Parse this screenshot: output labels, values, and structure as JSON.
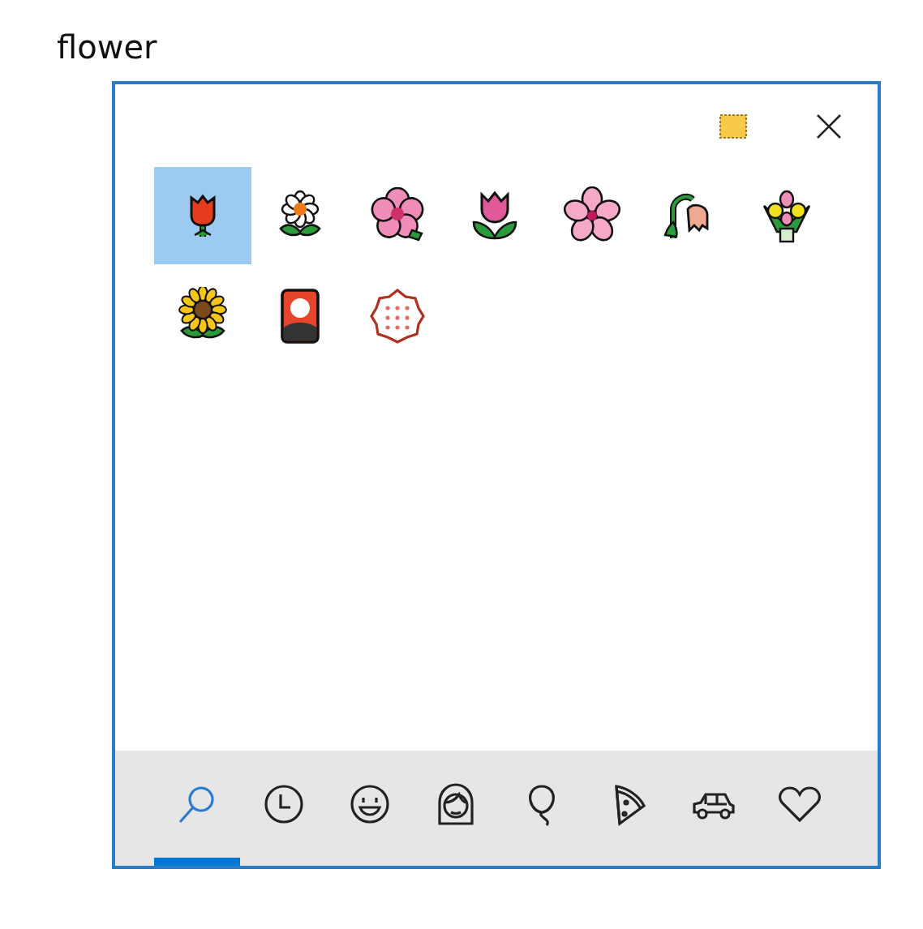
{
  "search": {
    "value": "flower"
  },
  "emojis": [
    {
      "kind": "rose",
      "selected": true
    },
    {
      "kind": "blossom",
      "selected": false
    },
    {
      "kind": "hibiscus",
      "selected": false
    },
    {
      "kind": "tulip",
      "selected": false
    },
    {
      "kind": "cherry",
      "selected": false
    },
    {
      "kind": "wilted",
      "selected": false
    },
    {
      "kind": "bouquet",
      "selected": false
    },
    {
      "kind": "sunflower",
      "selected": false
    },
    {
      "kind": "card",
      "selected": false
    },
    {
      "kind": "white",
      "selected": false
    }
  ],
  "tabs": [
    {
      "kind": "search",
      "selected": true
    },
    {
      "kind": "clock",
      "selected": false
    },
    {
      "kind": "smiley",
      "selected": false
    },
    {
      "kind": "person",
      "selected": false
    },
    {
      "kind": "balloon",
      "selected": false
    },
    {
      "kind": "pizza",
      "selected": false
    },
    {
      "kind": "car",
      "selected": false
    },
    {
      "kind": "heart",
      "selected": false
    }
  ]
}
